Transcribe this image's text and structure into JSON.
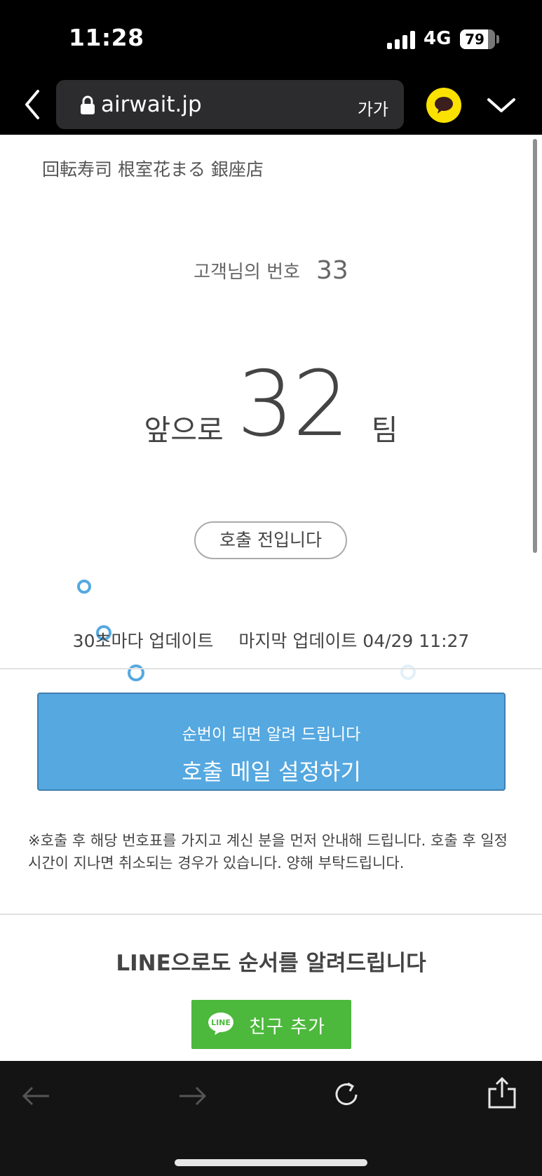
{
  "status_bar": {
    "time": "11:28",
    "network": "4G",
    "battery": "79",
    "battery_level": 0.79
  },
  "browser": {
    "url": "airwait.jp",
    "text_size_label": "가가"
  },
  "page": {
    "store_name": "回転寿司 根室花まる 銀座店",
    "ticket_label": "고객님의 번호",
    "ticket_number": "33",
    "wait_prefix": "앞으로",
    "wait_count": "32",
    "wait_suffix": "팀",
    "status_label": "호출 전입니다",
    "update_interval": "30초마다 업데이트",
    "last_update": "마지막 업데이트 04/29 11:27",
    "notify_button": {
      "subtitle": "순번이 되면 알려 드립니다",
      "label": "호출 메일 설정하기"
    },
    "notice": "※호출 후 해당 번호표를 가지고 계신 분을 먼저 안내해 드립니다. 호출 후 일정 시간이 지나면 취소되는 경우가 있습니다. 양해 부탁드립니다.",
    "line_title": "LINE으로도 순서를 알려드립니다",
    "line_button": {
      "logo_text": "LINE",
      "label": "친구 추가"
    }
  },
  "colors": {
    "accent_blue": "#55a8e0",
    "line_green": "#4cb83c",
    "kakao_yellow": "#fae100"
  },
  "icons": [
    "back-icon",
    "lock-icon",
    "kakao-talk-icon",
    "chevron-down-icon",
    "arrow-left-icon",
    "arrow-right-icon",
    "reload-icon",
    "share-icon"
  ]
}
